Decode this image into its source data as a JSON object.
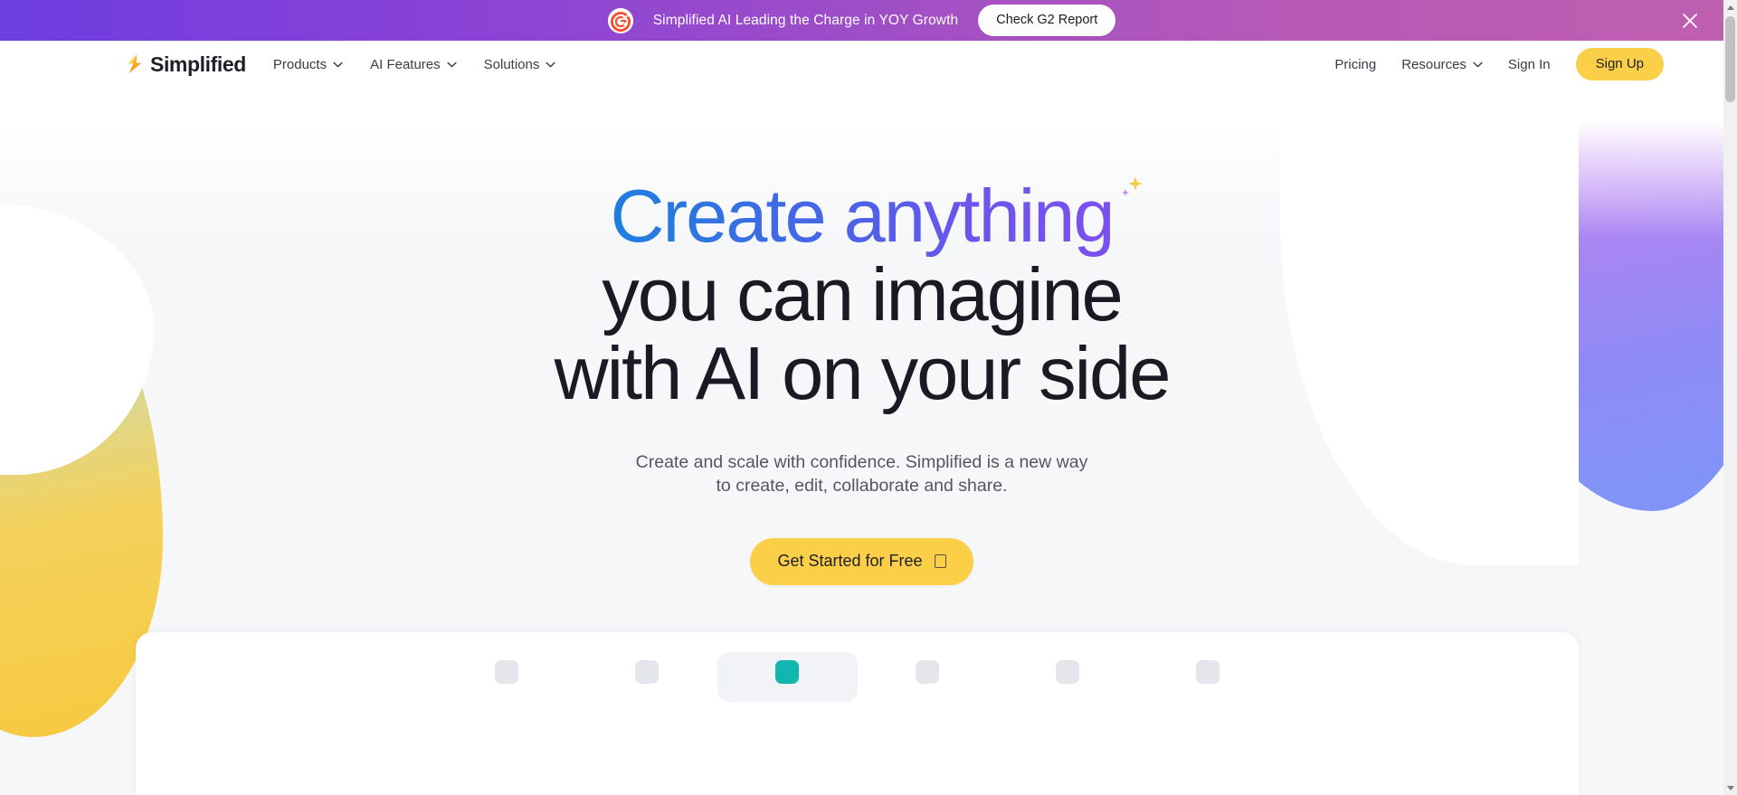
{
  "banner": {
    "icon": "g2-logo-icon",
    "text": "Simplified AI Leading the Charge in YOY Growth",
    "button_label": "Check G2 Report",
    "close_icon": "close-icon",
    "gradient_from": "#6d3ee0",
    "gradient_to": "#bf5fb0"
  },
  "nav": {
    "logo_text": "Simplified",
    "logo_mark": "simplified-s-mark-icon",
    "items": [
      {
        "label": "Products",
        "has_chevron": true
      },
      {
        "label": "AI Features",
        "has_chevron": true
      },
      {
        "label": "Solutions",
        "has_chevron": true
      }
    ],
    "right_items": [
      {
        "label": "Pricing",
        "has_chevron": false
      },
      {
        "label": "Resources",
        "has_chevron": true
      }
    ],
    "sign_in": "Sign In",
    "sign_up": "Sign Up",
    "signup_color": "#fbcf47"
  },
  "hero": {
    "headline_gradient": "Create anything",
    "headline_line2": "you can imagine",
    "headline_line3": "with AI on your side",
    "sparkle_icon": "sparkle-icon",
    "subtitle_line1": "Create and scale with confidence. Simplified is a new way",
    "subtitle_line2": "to create, edit, collaborate and share.",
    "cta_label": "Get Started for Free",
    "cta_icon": "arrow-right-icon",
    "cta_color": "#fbcf47",
    "gradient_from": "#1f7fe0",
    "gradient_to": "#7b50ee"
  },
  "decorations": {
    "left_blob_from": "#a9d8e0",
    "left_blob_to": "#f7c93f",
    "right_blob_from": "#d07df0",
    "right_blob_to": "#7d96f7"
  },
  "bottom_tools": [
    {
      "label": "",
      "active": false
    },
    {
      "label": "",
      "active": false
    },
    {
      "label": "",
      "active": true
    },
    {
      "label": "",
      "active": false
    },
    {
      "label": "",
      "active": false
    },
    {
      "label": "",
      "active": false
    }
  ],
  "scrollbar": {
    "up_icon": "scroll-up-arrow-icon",
    "down_icon": "scroll-down-arrow-icon"
  }
}
